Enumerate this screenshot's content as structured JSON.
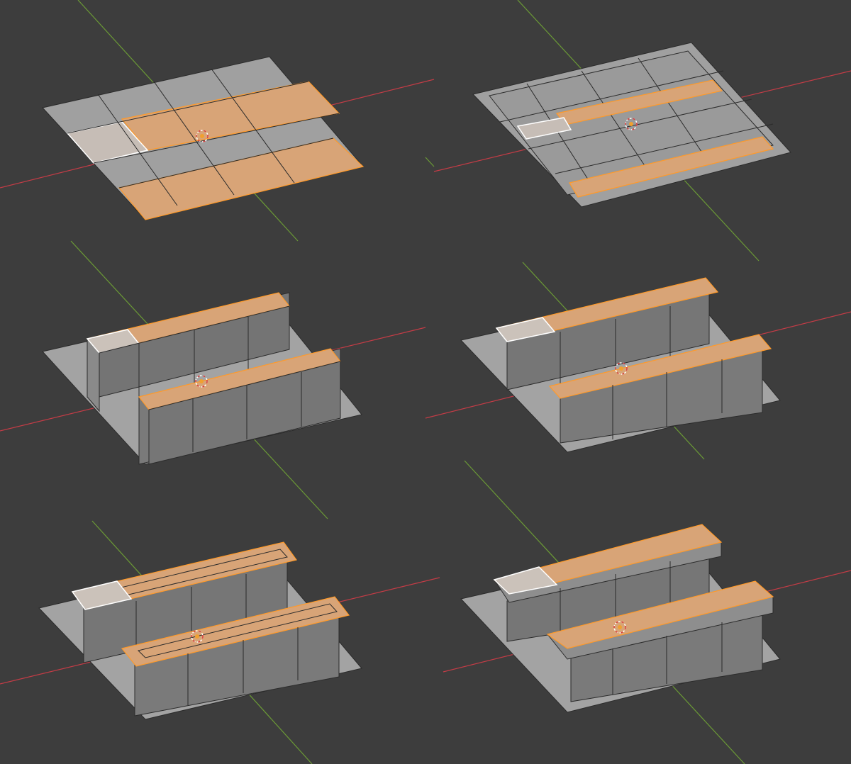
{
  "viewport": {
    "background": "#3d3d3d",
    "x_axis_color": "#c43c46",
    "y_axis_color": "#6b9a36"
  },
  "mesh_colors": {
    "face_light": "#a4a4a4",
    "face_mid": "#8a8a8a",
    "face_dark": "#6e6e6e",
    "face_side": "#757575",
    "edge": "#2b2b2b",
    "selected_face": "#d8a477",
    "selected_edge": "#ff9a2a",
    "active_face": "#c9c0b8",
    "active_edge": "#ffffff"
  },
  "panels": [
    {
      "step": 1,
      "mode": "flat-grid-selected"
    },
    {
      "step": 2,
      "mode": "inset-faces"
    },
    {
      "step": 3,
      "mode": "extrude-up"
    },
    {
      "step": 4,
      "mode": "extrude-outward-lip"
    },
    {
      "step": 5,
      "mode": "inset-top"
    },
    {
      "step": 6,
      "mode": "flat-top-cap"
    }
  ],
  "icons": {
    "origin": "3d-cursor-icon"
  }
}
